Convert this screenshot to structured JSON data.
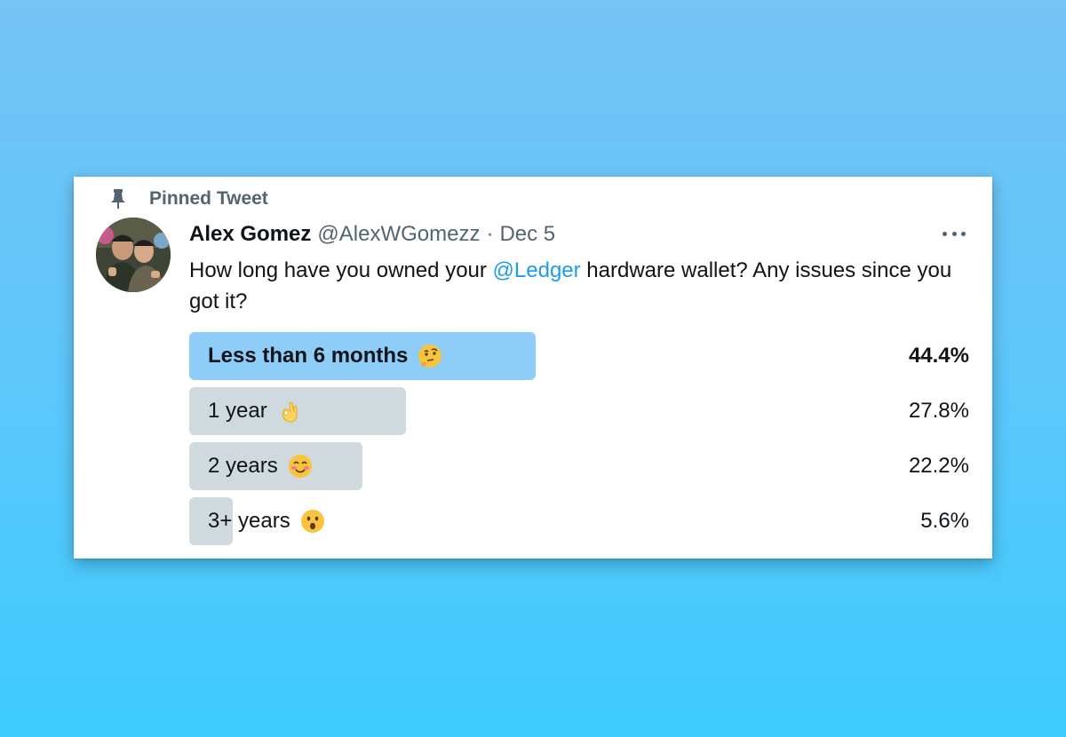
{
  "pinned_label": "Pinned Tweet",
  "author": {
    "name": "Alex Gomez",
    "handle": "@AlexWGomezz",
    "separator": "·",
    "date": "Dec 5"
  },
  "tweet": {
    "text_before": "How long have you owned your ",
    "mention": "@Ledger",
    "text_after": " hardware wallet? Any issues since you got it?"
  },
  "poll": {
    "options": [
      {
        "label": "Less than 6 months",
        "emoji": "thinking-face-emoji",
        "percent": "44.4%",
        "fraction": 0.444,
        "winner": true
      },
      {
        "label": "1 year",
        "emoji": "ok-hand-emoji",
        "percent": "27.8%",
        "fraction": 0.278,
        "winner": false
      },
      {
        "label": "2 years",
        "emoji": "smiling-face-emoji",
        "percent": "22.2%",
        "fraction": 0.222,
        "winner": false
      },
      {
        "label": "3+ years",
        "emoji": "astonished-face-emoji",
        "percent": "5.6%",
        "fraction": 0.056,
        "winner": false
      }
    ]
  },
  "colors": {
    "accent": "#1d9bf0",
    "winner_bar": "#8ecdf8",
    "option_bar": "#cfd9de",
    "secondary_text": "#536471"
  }
}
